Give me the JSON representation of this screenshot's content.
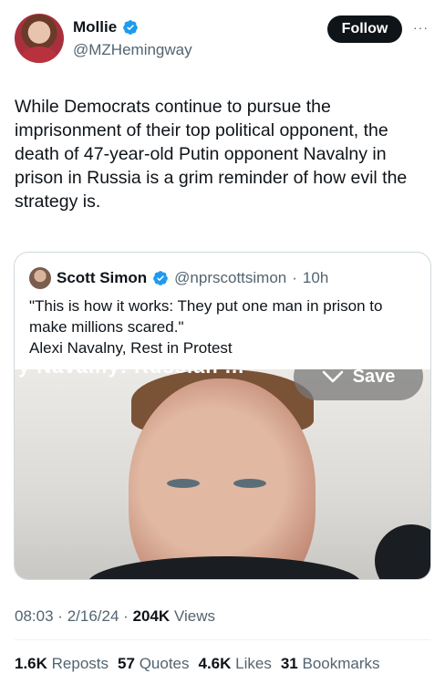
{
  "author": {
    "name": "Mollie",
    "handle": "@MZHemingway",
    "follow_label": "Follow",
    "more_label": "···"
  },
  "tweet": {
    "text": "While Democrats continue to pursue the imprisonment of their top political opponent, the death of 47-year-old Putin opponent Navalny in prison in Russia is a grim reminder of how evil the strategy is."
  },
  "quote": {
    "name": "Scott Simon",
    "handle": "@nprscottsimon",
    "separator": "·",
    "time": "10h",
    "line1": "\"This is how it works: They put one man in prison to make millions scared.\"",
    "line2": "Alexi Navalny, Rest in Protest",
    "media_caption": "y Navalny: Russian ...",
    "save_label": "Save"
  },
  "meta": {
    "time": "08:03",
    "date": "2/16/24",
    "views_count": "204K",
    "views_label": "Views",
    "sep": "·"
  },
  "stats": {
    "reposts_count": "1.6K",
    "reposts_label": "Reposts",
    "quotes_count": "57",
    "quotes_label": "Quotes",
    "likes_count": "4.6K",
    "likes_label": "Likes",
    "bookmarks_count": "31",
    "bookmarks_label": "Bookmarks"
  },
  "colors": {
    "verified": "#1d9bf0",
    "text_primary": "#0f1419",
    "text_secondary": "#536471"
  },
  "icons": {
    "verified": "verified-badge-icon",
    "save": "chevron-down-icon"
  }
}
